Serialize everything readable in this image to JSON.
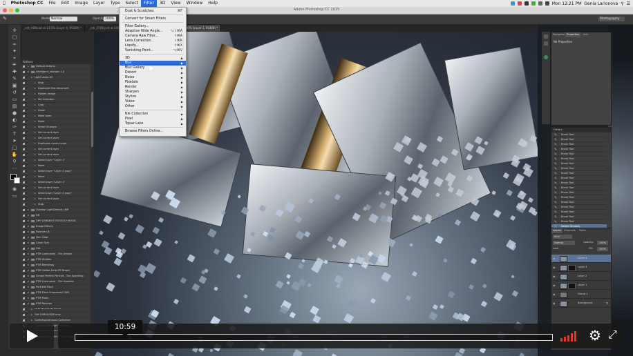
{
  "menubar": {
    "app": "Photoshop CC",
    "items": [
      "File",
      "Edit",
      "Image",
      "Layer",
      "Type",
      "Select",
      "Filter",
      "3D",
      "View",
      "Window",
      "Help"
    ],
    "active": "Filter",
    "clock": "Mon 12:21 PM",
    "user": "Genia Larionova"
  },
  "window": {
    "title": "Adobe Photoshop CC 2015"
  },
  "options": {
    "mode_label": "Mode:",
    "mode_value": "Normal",
    "opacity_label": "Opacity:",
    "opacity_value": "100%",
    "workspace": "Photography"
  },
  "tabs": [
    {
      "label": "_ndt_HENalut at 12.5% (Layer 4, RGB/8) *"
    },
    {
      "label": "_ndr_2708.psd at 100% (Layer 2, RGB/8)"
    },
    {
      "label": "Fine_Rings.psd at 100% (Layer 3, RGB/8) *"
    }
  ],
  "actions": {
    "title": "Actions",
    "rows": [
      {
        "label": "Default Actions",
        "indent": 0,
        "type": "folder"
      },
      {
        "label": "intelligent_sharpen 1.0",
        "indent": 0,
        "type": "folder"
      },
      {
        "label": "Light Leaks X3",
        "indent": 1,
        "type": "item"
      },
      {
        "label": "Stop",
        "indent": 2,
        "type": "item"
      },
      {
        "label": "Duplicate first document",
        "indent": 2,
        "type": "item"
      },
      {
        "label": "Flatten image",
        "indent": 2,
        "type": "item"
      },
      {
        "label": "Set Selection",
        "indent": 2,
        "type": "item"
      },
      {
        "label": "Crop",
        "indent": 2,
        "type": "item"
      },
      {
        "label": "Close",
        "indent": 2,
        "type": "item"
      },
      {
        "label": "Make layer",
        "indent": 2,
        "type": "item"
      },
      {
        "label": "Paste",
        "indent": 2,
        "type": "item"
      },
      {
        "label": "Smart Sharpen",
        "indent": 2,
        "type": "item"
      },
      {
        "label": "Set current layer",
        "indent": 2,
        "type": "item"
      },
      {
        "label": "Set current layer",
        "indent": 2,
        "type": "item"
      },
      {
        "label": "Duplicate current layer",
        "indent": 2,
        "type": "item"
      },
      {
        "label": "Set current layer",
        "indent": 2,
        "type": "item"
      },
      {
        "label": "Set current layer",
        "indent": 2,
        "type": "item"
      },
      {
        "label": "Select layer \"Layer 1\"",
        "indent": 2,
        "type": "item"
      },
      {
        "label": "Make",
        "indent": 2,
        "type": "item"
      },
      {
        "label": "Select layer \"Layer 1 copy\"",
        "indent": 2,
        "type": "item"
      },
      {
        "label": "Move",
        "indent": 2,
        "type": "item"
      },
      {
        "label": "Select layer \"Layer 1\"",
        "indent": 2,
        "type": "item"
      },
      {
        "label": "Set current layer",
        "indent": 2,
        "type": "item"
      },
      {
        "label": "Select layer \"Layer 1 copy\"",
        "indent": 2,
        "type": "item"
      },
      {
        "label": "Set current layer",
        "indent": 2,
        "type": "item"
      },
      {
        "label": "Stop",
        "indent": 2,
        "type": "item"
      },
      {
        "label": "Outdoor Light/Details LRM",
        "indent": 0,
        "type": "folder"
      },
      {
        "label": "DR",
        "indent": 0,
        "type": "folder"
      },
      {
        "label": "DRY GARDEN'S RETOUCH BOOK",
        "indent": 0,
        "type": "folder"
      },
      {
        "label": "Image Effects",
        "indent": 0,
        "type": "folder"
      },
      {
        "label": "Polarize LB",
        "indent": 0,
        "type": "folder"
      },
      {
        "label": "Skin Glow",
        "indent": 0,
        "type": "folder"
      },
      {
        "label": "Clean Skin",
        "indent": 0,
        "type": "folder"
      },
      {
        "label": "Hdr",
        "indent": 0,
        "type": "folder"
      },
      {
        "label": "PTM Luminosity - The Artisan",
        "indent": 0,
        "type": "folder"
      },
      {
        "label": "PTM Utilities",
        "indent": 0,
        "type": "folder"
      },
      {
        "label": "PTM Blendings",
        "indent": 0,
        "type": "folder"
      },
      {
        "label": "PTM Coffee Artist PS Brown",
        "indent": 0,
        "type": "folder"
      },
      {
        "label": "Simply Perfect Portrait - The Sparkling",
        "indent": 0,
        "type": "folder"
      },
      {
        "label": "PTM Luminosity - The Essentia",
        "indent": 0,
        "type": "folder"
      },
      {
        "label": "Portraits Back",
        "indent": 0,
        "type": "folder"
      },
      {
        "label": "PTM Flash Sharpened TWO",
        "indent": 0,
        "type": "folder"
      },
      {
        "label": "PTM Moon",
        "indent": 0,
        "type": "folder"
      },
      {
        "label": "PTM Reviews",
        "indent": 0,
        "type": "folder"
      },
      {
        "label": "••••••••••••••••••",
        "indent": 1,
        "type": "item"
      },
      {
        "label": "Get 10MGS/SDB only",
        "indent": 1,
        "type": "item"
      },
      {
        "label": "Contemporaneous Collection",
        "indent": 1,
        "type": "item"
      },
      {
        "label": "Contemporaneous Collection",
        "indent": 1,
        "type": "item"
      },
      {
        "label": "••••••••••••••••••",
        "indent": 1,
        "type": "item"
      },
      {
        "label": "Dream Watch Art in One Huge Stroke",
        "indent": 0,
        "type": "folder"
      }
    ]
  },
  "filter_menu": [
    {
      "label": "Dust & Scratches",
      "shortcut": "⌘F",
      "sep_after": true
    },
    {
      "label": "Convert for Smart Filters",
      "sep_after": true
    },
    {
      "label": "Filter Gallery..."
    },
    {
      "label": "Adaptive Wide Angle...",
      "shortcut": "⌥⇧⌘A"
    },
    {
      "label": "Camera Raw Filter...",
      "shortcut": "⇧⌘A"
    },
    {
      "label": "Lens Correction...",
      "shortcut": "⇧⌘R"
    },
    {
      "label": "Liquify...",
      "shortcut": "⇧⌘X"
    },
    {
      "label": "Vanishing Point...",
      "shortcut": "⌥⌘V",
      "sep_after": true
    },
    {
      "label": "3D",
      "submenu": true
    },
    {
      "label": "Blur",
      "submenu": true,
      "highlight": true
    },
    {
      "label": "Blur Gallery",
      "submenu": true
    },
    {
      "label": "Distort",
      "submenu": true
    },
    {
      "label": "Noise",
      "submenu": true
    },
    {
      "label": "Pixelate",
      "submenu": true
    },
    {
      "label": "Render",
      "submenu": true
    },
    {
      "label": "Sharpen",
      "submenu": true
    },
    {
      "label": "Stylize",
      "submenu": true
    },
    {
      "label": "Video",
      "submenu": true
    },
    {
      "label": "Other",
      "submenu": true,
      "sep_after": true
    },
    {
      "label": "Nik Collection",
      "submenu": true
    },
    {
      "label": "Pixel",
      "submenu": true
    },
    {
      "label": "Topaz Labs",
      "submenu": true,
      "sep_after": true
    },
    {
      "label": "Browse Filters Online..."
    }
  ],
  "properties": {
    "tabs": [
      "Navigator",
      "Properties",
      "Info"
    ],
    "active": "Properties",
    "empty_text": "No Properties"
  },
  "history": {
    "title": "History",
    "rows": [
      "Brush Tool",
      "Brush Tool",
      "Brush Tool",
      "Brush Tool",
      "Brush Tool",
      "Brush Tool",
      "Brush Tool",
      "Brush Tool",
      "Brush Tool",
      "Brush Tool",
      "Brush Tool",
      "Brush Tool",
      "Brush Tool",
      "Brush Tool",
      "Brush Tool",
      "Brush Tool",
      "Brush Tool",
      "Brush Tool",
      "Brush Tool",
      "Delete Shadow"
    ],
    "selected_index": 19
  },
  "layers": {
    "tabs": [
      "Layers",
      "Channels",
      "Paths"
    ],
    "kind": "Kind",
    "blend": "Normal",
    "opacity_label": "Opacity:",
    "opacity": "100%",
    "lock_label": "Lock:",
    "fill_label": "Fill:",
    "fill": "100%",
    "rows": [
      {
        "name": "Layer 4",
        "mask": false,
        "selected": true
      },
      {
        "name": "Layer 3",
        "mask": true,
        "selected": false
      },
      {
        "name": "Layer 2",
        "mask": false,
        "selected": false
      },
      {
        "name": "Layer 1",
        "mask": true,
        "selected": false
      },
      {
        "name": "Group 1",
        "mask": false,
        "selected": false,
        "group": true
      },
      {
        "name": "Background",
        "mask": false,
        "selected": false,
        "lock": true
      }
    ]
  },
  "player": {
    "time": "10:59",
    "progress": 0
  },
  "colors": {
    "accent": "#2f6ad6",
    "volume": "#e8352d",
    "selection": "#5b7396"
  }
}
